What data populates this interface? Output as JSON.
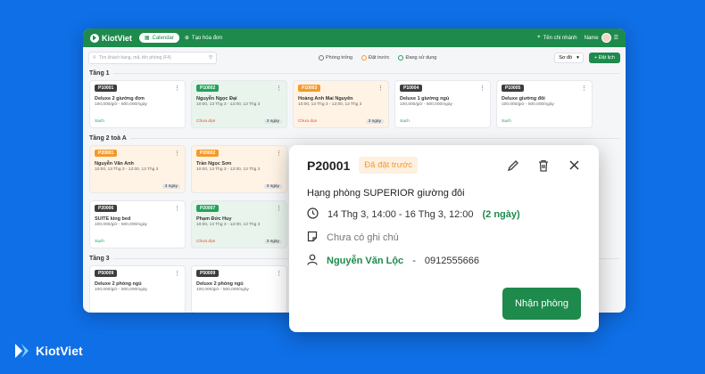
{
  "topbar": {
    "brand": "KiotViet",
    "calendar_tab": "Calendar",
    "new_invoice": "Tạo hóa đơn",
    "branch": "Tên chi nhánh",
    "user": "Name"
  },
  "toolbar": {
    "search_placeholder": "Tìm khách hàng, mã, tên phòng (F4)",
    "filters": [
      "Phòng trống",
      "Đặt trước",
      "Đang sử dụng"
    ],
    "view": "Sơ đồ",
    "book_button": "+ Đặt lịch"
  },
  "sections": [
    {
      "title": "Tầng 1",
      "rooms": [
        {
          "code": "P10001",
          "title": "Deluxe 2 giường đơn",
          "sub": "100,000/giờ - 500,000/ngày",
          "status": "Sạch",
          "nights": "",
          "color": "white",
          "status_color": "green"
        },
        {
          "code": "P10002",
          "title": "Nguyễn Ngọc Đại",
          "sub": "10:00, 13 Thg 3 - 12:00, 13 Thg 3",
          "status": "Chưa dọn",
          "nights": "3 ngày",
          "color": "green",
          "status_color": "red"
        },
        {
          "code": "P10003",
          "title": "Hoàng Anh Mai Nguyên",
          "sub": "10:00, 13 Thg 3 - 12:00, 13 Thg 3",
          "status": "Chưa dọn",
          "nights": "3 ngày",
          "color": "orange",
          "status_color": "red"
        },
        {
          "code": "P10004",
          "title": "Deluxe 1 giường ngủ",
          "sub": "100,000/giờ - 500,000/ngày",
          "status": "Sạch",
          "nights": "",
          "color": "white",
          "status_color": "green"
        },
        {
          "code": "P10005",
          "title": "Deluxe giường đôi",
          "sub": "100,000/giờ - 500,000/ngày",
          "status": "Sạch",
          "nights": "",
          "color": "white",
          "status_color": "green"
        }
      ]
    },
    {
      "title": "Tầng 2 toà A",
      "rooms": [
        {
          "code": "P20001",
          "title": "Nguyễn Văn Anh",
          "sub": "10:00, 13 Thg 3 - 12:00, 13 Thg 3",
          "status": "",
          "nights": "3 ngày",
          "color": "orange",
          "status_color": "green"
        },
        {
          "code": "P20002",
          "title": "Trần Ngọc Sơn",
          "sub": "10:00, 13 Thg 3 - 12:00, 13 Thg 3",
          "status": "",
          "nights": "3 ngày",
          "color": "orange",
          "status_color": "green"
        }
      ]
    },
    {
      "title": "",
      "rooms": [
        {
          "code": "P20006",
          "title": "SUITE king bed",
          "sub": "100,000/giờ - 500,000/ngày",
          "status": "Sạch",
          "nights": "",
          "color": "white",
          "status_color": "green"
        },
        {
          "code": "P20007",
          "title": "Phạm Đức Huy",
          "sub": "10:00, 13 Thg 3 - 12:00, 13 Thg 3",
          "status": "Chưa dọn",
          "nights": "3 ngày",
          "color": "green",
          "status_color": "red"
        }
      ]
    },
    {
      "title": "Tầng 3",
      "rooms": [
        {
          "code": "P50009",
          "title": "Deluxe 2 phòng ngủ",
          "sub": "100,000/giờ - 500,000/ngày",
          "status": "",
          "nights": "",
          "color": "white",
          "status_color": "green"
        },
        {
          "code": "P50009",
          "title": "Deluxe 2 phòng ngủ",
          "sub": "100,000/giờ - 500,000/ngày",
          "status": "",
          "nights": "",
          "color": "white",
          "status_color": "green"
        }
      ]
    }
  ],
  "popup": {
    "code": "P20001",
    "status": "Đã đặt trước",
    "room_type": "Hạng phòng SUPERIOR giường đôi",
    "time": "14 Thg 3, 14:00 - 16 Thg 3, 12:00",
    "duration": "(2 ngày)",
    "note": "Chưa có ghi chú",
    "guest": "Nguyễn Văn Lộc",
    "separator": "-",
    "phone": "0912555666",
    "checkin_button": "Nhận phòng"
  },
  "brand_bottom": "KiotViet"
}
